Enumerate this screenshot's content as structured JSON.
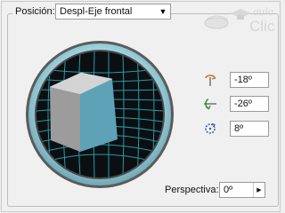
{
  "position": {
    "label": "Posición:",
    "selected": "Despl-Eje frontal"
  },
  "watermark": {
    "line1": "aula",
    "line2": "Clic"
  },
  "rotations": [
    {
      "icon": "rotate-x-icon",
      "value": "-18º"
    },
    {
      "icon": "rotate-y-icon",
      "value": "-26º"
    },
    {
      "icon": "rotate-z-icon",
      "value": "8º"
    }
  ],
  "perspective": {
    "label": "Perspectiva:",
    "value": "0º"
  },
  "colors": {
    "cube_front": "#5ea2b8",
    "cube_side": "#9c9c9c",
    "cube_top": "#d4d4d4",
    "dial_ring": "#8fd0dc",
    "dial_grid": "#2aa9b9"
  }
}
